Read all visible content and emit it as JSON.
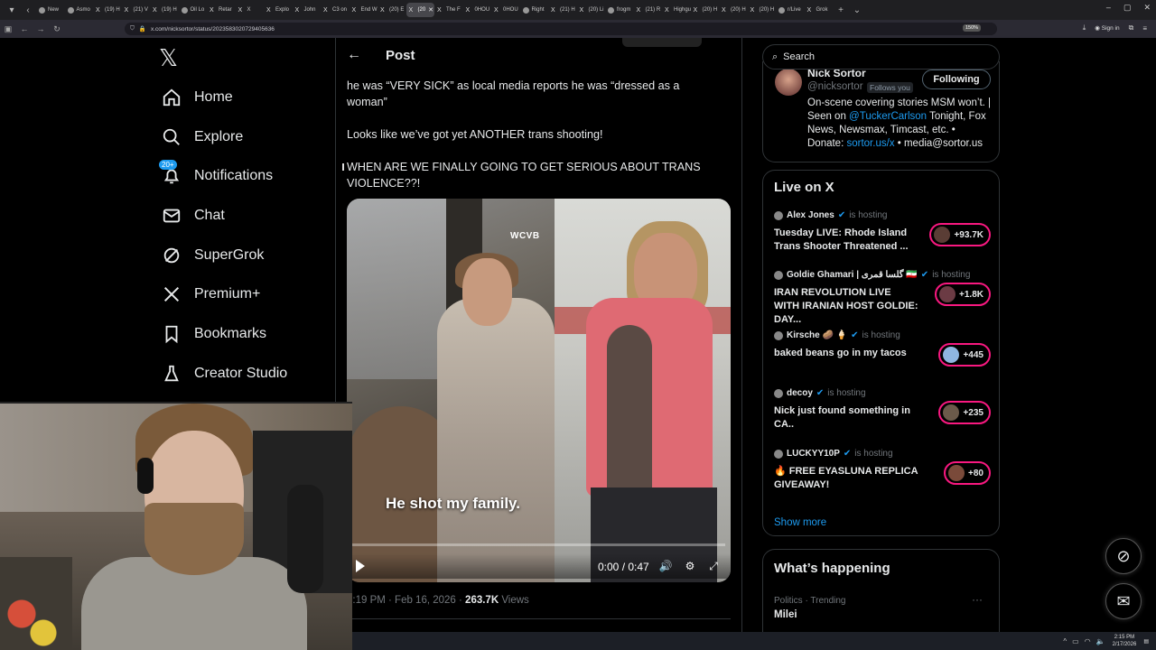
{
  "browser": {
    "tabs": [
      {
        "label": "New",
        "icon": "firefox-icon"
      },
      {
        "label": "Asmo",
        "icon": "avatar-icon"
      },
      {
        "label": "(19) H",
        "icon": "x-icon"
      },
      {
        "label": "(21) V",
        "icon": "x-icon"
      },
      {
        "label": "(19) H",
        "icon": "x-icon"
      },
      {
        "label": "Oil Lo",
        "icon": "globe-icon"
      },
      {
        "label": "Retar",
        "icon": "x-icon"
      },
      {
        "label": "X",
        "icon": "x-icon"
      },
      {
        "label": "Explo",
        "icon": "x-icon"
      },
      {
        "label": "John",
        "icon": "x-icon"
      },
      {
        "label": "C3 on",
        "icon": "x-icon"
      },
      {
        "label": "End W",
        "icon": "x-icon"
      },
      {
        "label": "(20) E",
        "icon": "x-icon"
      },
      {
        "label": "(20",
        "icon": "x-icon",
        "active": true
      },
      {
        "label": "The F",
        "icon": "x-icon"
      },
      {
        "label": "0HOU",
        "icon": "x-icon"
      },
      {
        "label": "0HOU",
        "icon": "x-icon"
      },
      {
        "label": "Right",
        "icon": "globe-icon"
      },
      {
        "label": "(21) H",
        "icon": "x-icon"
      },
      {
        "label": "(20) Li",
        "icon": "x-icon"
      },
      {
        "label": "frogm",
        "icon": "globe-icon"
      },
      {
        "label": "(21) R",
        "icon": "x-icon"
      },
      {
        "label": "Highgue",
        "icon": "x-icon"
      },
      {
        "label": "(20) H",
        "icon": "x-icon"
      },
      {
        "label": "(20) H",
        "icon": "x-icon"
      },
      {
        "label": "(20) H",
        "icon": "x-icon"
      },
      {
        "label": "r/Live",
        "icon": "reddit-icon"
      },
      {
        "label": "Grok",
        "icon": "x-icon"
      }
    ],
    "url": "x.com/nicksortor/status/2023583020729405636",
    "zoom": "150%",
    "signin": "Sign in"
  },
  "sidebar": {
    "logo": "𝕏",
    "items": [
      {
        "label": "Home",
        "icon": "home-icon"
      },
      {
        "label": "Explore",
        "icon": "search-icon"
      },
      {
        "label": "Notifications",
        "icon": "bell-icon",
        "badge": "20+"
      },
      {
        "label": "Chat",
        "icon": "mail-icon"
      },
      {
        "label": "SuperGrok",
        "icon": "grok-icon"
      },
      {
        "label": "Premium+",
        "icon": "x-icon"
      },
      {
        "label": "Bookmarks",
        "icon": "bookmark-icon"
      },
      {
        "label": "Creator Studio",
        "icon": "flask-icon"
      }
    ]
  },
  "post": {
    "header_title": "Post",
    "paragraphs": [
      "he was “VERY SICK” as local media reports he was “dressed as a woman”",
      "Looks like we’ve got yet ANOTHER trans shooting!",
      "WHEN ARE WE FINALLY GOING TO GET SERIOUS ABOUT TRANS VIOLENCE??!"
    ],
    "video": {
      "watermark": "WCVB",
      "caption": "He shot my family.",
      "time": "0:00 / 0:47",
      "progress": 0
    },
    "meta": {
      "time": "3:19 PM · Feb 16, 2026 · ",
      "views_count": "263.7K",
      "views_label": " Views"
    }
  },
  "right": {
    "search_placeholder": "Search",
    "profile": {
      "name": "Nick Sortor",
      "handle": "@nicksortor",
      "follows_you": "Follows you",
      "follow_label": "Following",
      "bio_parts": [
        "On-scene covering stories MSM won’t. | Seen on ",
        "@TuckerCarlson",
        " Tonight, Fox News, Newsmax, Timcast, etc. • Donate: ",
        "sortor.us/x",
        " • media@sortor.us"
      ]
    },
    "live": {
      "title": "Live on X",
      "hosting_label": "is hosting",
      "items": [
        {
          "host": "Alex Jones",
          "title": "Tuesday LIVE: Rhode Island Trans Shooter Threatened ...",
          "count": "+93.7K"
        },
        {
          "host": "Goldie Ghamari | گلسا قمری 🇮🇷",
          "title": "IRAN REVOLUTION LIVE WITH IRANIAN HOST GOLDIE: DAY...",
          "count": "+1.8K"
        },
        {
          "host": "Kirsche 🥔 🍦",
          "title": "baked beans go in my tacos",
          "count": "+445"
        },
        {
          "host": "decoy",
          "title": "Nick just found something in CA..",
          "count": "+235"
        },
        {
          "host": "LUCKYY10P",
          "title": "🔥 FREE EYASLUNA REPLICA GIVEAWAY!",
          "count": "+80"
        }
      ],
      "show_more": "Show more"
    },
    "happening": {
      "title": "What’s happening",
      "trend_category": "Politics · Trending",
      "trend_name": "Milei"
    }
  },
  "taskbar": {
    "time": "2:15 PM",
    "date": "2/17/2026"
  },
  "colors": {
    "accent": "#1d9bf0",
    "live_ring": "#f91880",
    "background": "#000000",
    "muted": "#71767b"
  }
}
